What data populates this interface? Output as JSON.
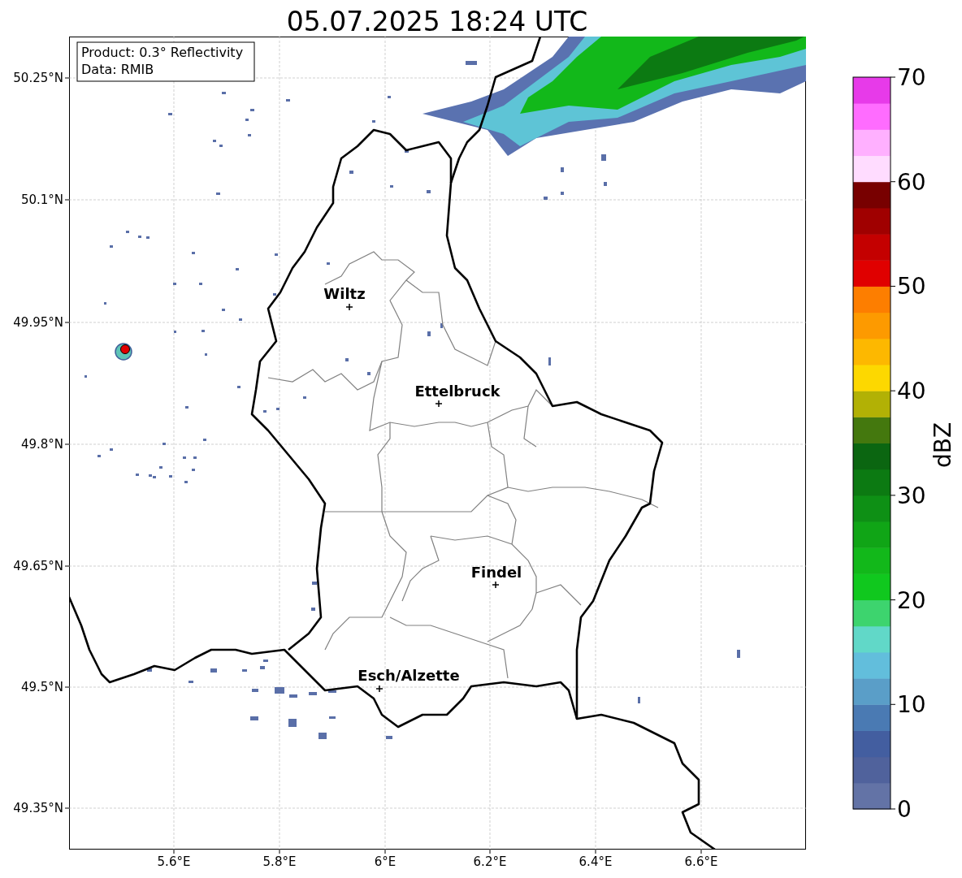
{
  "title": "05.07.2025 18:24 UTC",
  "info_box": [
    "Product: 0.3° Reflectivity",
    "Data: RMIB"
  ],
  "map": {
    "x_ticks": [
      "5.6°E",
      "5.8°E",
      "6°E",
      "6.2°E",
      "6.4°E",
      "6.6°E"
    ],
    "y_ticks": [
      "50.25°N",
      "50.1°N",
      "49.95°N",
      "49.8°N",
      "49.65°N",
      "49.5°N",
      "49.35°N"
    ],
    "cities": [
      "Wiltz",
      "Ettelbruck",
      "Findel",
      "Esch/Alzette"
    ]
  },
  "colorbar": {
    "label": "dBZ",
    "ticks": [
      "70",
      "60",
      "50",
      "40",
      "30",
      "20",
      "10",
      "0"
    ],
    "bins": [
      {
        "color": "#6373a6"
      },
      {
        "color": "#50629c"
      },
      {
        "color": "#435ea0"
      },
      {
        "color": "#4a7ab3"
      },
      {
        "color": "#5a9ec8"
      },
      {
        "color": "#62bedc"
      },
      {
        "color": "#61d8c8"
      },
      {
        "color": "#3dd46e"
      },
      {
        "color": "#10c81e"
      },
      {
        "color": "#12b81a"
      },
      {
        "color": "#10a516"
      },
      {
        "color": "#0e9015"
      },
      {
        "color": "#0c7a12"
      },
      {
        "color": "#0b6611"
      },
      {
        "color": "#44780e"
      },
      {
        "color": "#b2b105"
      },
      {
        "color": "#fdd800"
      },
      {
        "color": "#fdb800"
      },
      {
        "color": "#fd9a00"
      },
      {
        "color": "#fd7e00"
      },
      {
        "color": "#e00000"
      },
      {
        "color": "#c40000"
      },
      {
        "color": "#a00000"
      },
      {
        "color": "#780000"
      },
      {
        "color": "#ffdcff"
      },
      {
        "color": "#ffb0ff"
      },
      {
        "color": "#ff6cff"
      },
      {
        "color": "#e73ae9"
      }
    ]
  }
}
